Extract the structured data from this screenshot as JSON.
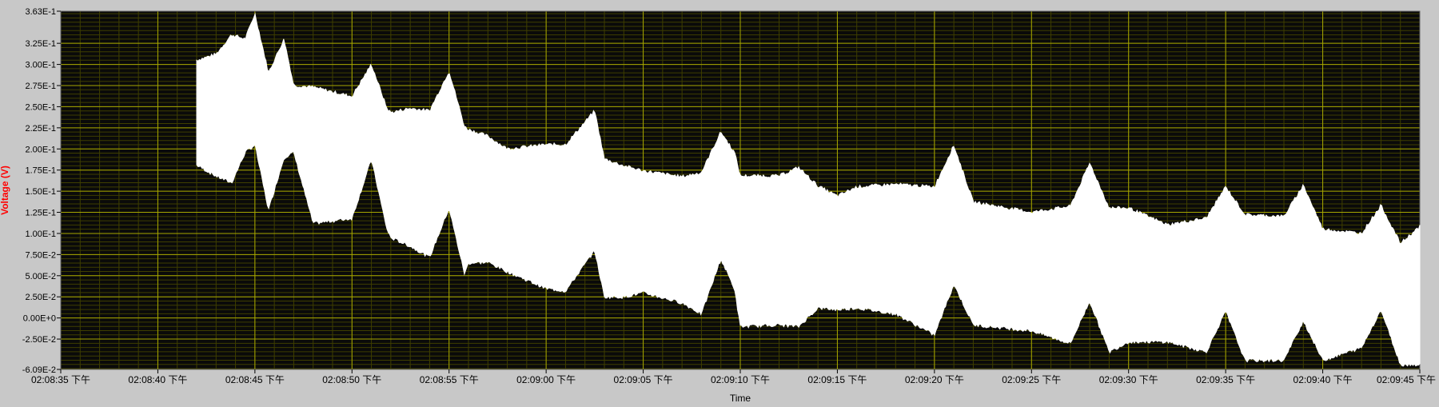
{
  "colors": {
    "background": "#c8c8c8",
    "plot_area": "#0a0a0a",
    "grid_major": "#a6a600",
    "grid_minor": "#3e3e00",
    "trace": "#ffffff",
    "ylabel": "#ff0000",
    "tick_text": "#000000"
  },
  "chart_data": {
    "type": "area",
    "title": "",
    "xlabel": "Time",
    "ylabel": "Voltage (V)",
    "xlim": [
      "02:08:35",
      "02:09:45"
    ],
    "ylim": [
      -0.0609,
      0.363
    ],
    "grid": true,
    "x_ticks": [
      "02:08:35 下午",
      "02:08:40 下午",
      "02:08:45 下午",
      "02:08:50 下午",
      "02:08:55 下午",
      "02:09:00 下午",
      "02:09:05 下午",
      "02:09:10 下午",
      "02:09:15 下午",
      "02:09:20 下午",
      "02:09:25 下午",
      "02:09:30 下午",
      "02:09:35 下午",
      "02:09:40 下午",
      "02:09:45 下午"
    ],
    "y_ticks": [
      {
        "value": 0.363,
        "label": "3.63E-1"
      },
      {
        "value": 0.325,
        "label": "3.25E-1"
      },
      {
        "value": 0.3,
        "label": "3.00E-1"
      },
      {
        "value": 0.275,
        "label": "2.75E-1"
      },
      {
        "value": 0.25,
        "label": "2.50E-1"
      },
      {
        "value": 0.225,
        "label": "2.25E-1"
      },
      {
        "value": 0.2,
        "label": "2.00E-1"
      },
      {
        "value": 0.175,
        "label": "1.75E-1"
      },
      {
        "value": 0.15,
        "label": "1.50E-1"
      },
      {
        "value": 0.125,
        "label": "1.25E-1"
      },
      {
        "value": 0.1,
        "label": "1.00E-1"
      },
      {
        "value": 0.075,
        "label": "7.50E-2"
      },
      {
        "value": 0.05,
        "label": "5.00E-2"
      },
      {
        "value": 0.025,
        "label": "2.50E-2"
      },
      {
        "value": 0.0,
        "label": "0.00E+0"
      },
      {
        "value": -0.025,
        "label": "-2.50E-2"
      },
      {
        "value": -0.0609,
        "label": "-6.09E-2"
      }
    ],
    "series": [
      {
        "x": [
          "02:08:42",
          "02:08:43",
          "02:08:43.8",
          "02:08:44.5",
          "02:08:45",
          "02:08:45.7",
          "02:08:46.5",
          "02:08:47",
          "02:08:48",
          "02:08:50",
          "02:08:51",
          "02:08:51.8",
          "02:08:52",
          "02:08:53",
          "02:08:54",
          "02:08:55",
          "02:08:55.8",
          "02:08:56",
          "02:08:57",
          "02:08:58",
          "02:09:00",
          "02:09:01",
          "02:09:02.5",
          "02:09:03",
          "02:09:04",
          "02:09:05",
          "02:09:07",
          "02:09:08",
          "02:09:09",
          "02:09:09.7",
          "02:09:10",
          "02:09:12",
          "02:09:13",
          "02:09:14",
          "02:09:15",
          "02:09:16",
          "02:09:18",
          "02:09:20",
          "02:09:21",
          "02:09:22",
          "02:09:25",
          "02:09:27",
          "02:09:28",
          "02:09:29",
          "02:09:30",
          "02:09:32",
          "02:09:34",
          "02:09:35",
          "02:09:36",
          "02:09:38",
          "02:09:39",
          "02:09:40",
          "02:09:42",
          "02:09:43",
          "02:09:44",
          "02:09:45"
        ],
        "upper": [
          0.305,
          0.312,
          0.335,
          0.33,
          0.36,
          0.29,
          0.33,
          0.275,
          0.273,
          0.262,
          0.3,
          0.248,
          0.243,
          0.248,
          0.245,
          0.292,
          0.226,
          0.223,
          0.215,
          0.2,
          0.205,
          0.205,
          0.245,
          0.188,
          0.18,
          0.174,
          0.167,
          0.172,
          0.22,
          0.196,
          0.168,
          0.168,
          0.178,
          0.156,
          0.144,
          0.155,
          0.158,
          0.155,
          0.204,
          0.137,
          0.125,
          0.132,
          0.183,
          0.13,
          0.13,
          0.11,
          0.118,
          0.155,
          0.122,
          0.12,
          0.157,
          0.105,
          0.1,
          0.133,
          0.088,
          0.108
        ],
        "lower": [
          0.181,
          0.168,
          0.16,
          0.196,
          0.205,
          0.128,
          0.19,
          0.196,
          0.112,
          0.118,
          0.188,
          0.105,
          0.095,
          0.085,
          0.072,
          0.13,
          0.052,
          0.065,
          0.066,
          0.055,
          0.035,
          0.032,
          0.08,
          0.025,
          0.025,
          0.03,
          0.018,
          0.005,
          0.07,
          0.035,
          -0.01,
          -0.008,
          -0.01,
          0.012,
          0.01,
          0.012,
          0.005,
          -0.02,
          0.04,
          -0.008,
          -0.015,
          -0.03,
          0.02,
          -0.04,
          -0.028,
          -0.028,
          -0.04,
          0.008,
          -0.05,
          -0.05,
          -0.003,
          -0.05,
          -0.035,
          0.01,
          -0.055,
          -0.055
        ]
      }
    ]
  }
}
